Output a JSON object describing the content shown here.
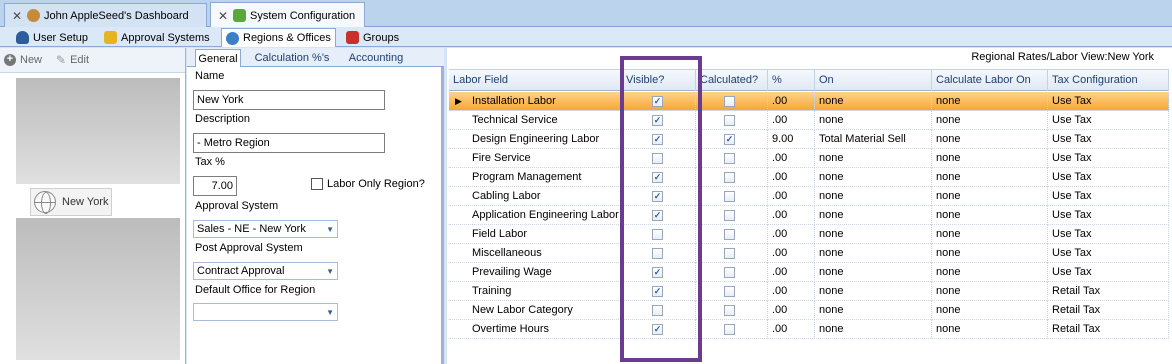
{
  "doc_tabs": [
    {
      "label": "John AppleSeed's Dashboard",
      "icon": "dashboard-icon"
    },
    {
      "label": "System Configuration",
      "icon": "puzzle-icon"
    }
  ],
  "module_tabs": [
    {
      "label": "User Setup",
      "icon": "user-icon"
    },
    {
      "label": "Approval Systems",
      "icon": "approval-icon"
    },
    {
      "label": "Regions & Offices",
      "icon": "globe-icon"
    },
    {
      "label": "Groups",
      "icon": "groups-icon"
    }
  ],
  "left_toolbar": {
    "new_label": "New",
    "edit_label": "Edit"
  },
  "region_list": {
    "selected": "New York"
  },
  "form_tabs": [
    "General",
    "Calculation %'s",
    "Accounting"
  ],
  "form": {
    "name_label": "Name",
    "name_value": "New York",
    "description_label": "Description",
    "description_value": "- Metro Region",
    "tax_label": "Tax %",
    "tax_value": "7.00",
    "labor_only_label": "Labor Only Region?",
    "approval_system_label": "Approval System",
    "approval_system_value": "Sales - NE - New York",
    "post_approval_label": "Post Approval System",
    "post_approval_value": "Contract Approval",
    "default_office_label": "Default Office for Region",
    "default_office_value": ""
  },
  "grid": {
    "title": "Regional Rates/Labor View:New York",
    "headers": [
      "Labor Field",
      "Visible?",
      "Calculated?",
      "%",
      "On",
      "Calculate Labor On",
      "Tax Configuration"
    ],
    "rows": [
      {
        "field": "Installation Labor",
        "visible": true,
        "calculated": false,
        "pct": ".00",
        "on": "none",
        "calc_on": "none",
        "tax": "Use Tax",
        "selected": true
      },
      {
        "field": "Technical Service",
        "visible": true,
        "calculated": false,
        "pct": ".00",
        "on": "none",
        "calc_on": "none",
        "tax": "Use Tax"
      },
      {
        "field": "Design Engineering Labor",
        "visible": true,
        "calculated": true,
        "pct": "9.00",
        "on": "Total Material Sell",
        "calc_on": "none",
        "tax": "Use Tax"
      },
      {
        "field": "Fire Service",
        "visible": false,
        "calculated": false,
        "pct": ".00",
        "on": "none",
        "calc_on": "none",
        "tax": "Use Tax"
      },
      {
        "field": "Program Management",
        "visible": true,
        "calculated": false,
        "pct": ".00",
        "on": "none",
        "calc_on": "none",
        "tax": "Use Tax"
      },
      {
        "field": "Cabling Labor",
        "visible": true,
        "calculated": false,
        "pct": ".00",
        "on": "none",
        "calc_on": "none",
        "tax": "Use Tax"
      },
      {
        "field": "Application Engineering Labor",
        "visible": true,
        "calculated": false,
        "pct": ".00",
        "on": "none",
        "calc_on": "none",
        "tax": "Use Tax"
      },
      {
        "field": "Field Labor",
        "visible": false,
        "calculated": false,
        "pct": ".00",
        "on": "none",
        "calc_on": "none",
        "tax": "Use Tax"
      },
      {
        "field": "Miscellaneous",
        "visible": false,
        "calculated": false,
        "pct": ".00",
        "on": "none",
        "calc_on": "none",
        "tax": "Use Tax"
      },
      {
        "field": "Prevailing Wage",
        "visible": true,
        "calculated": false,
        "pct": ".00",
        "on": "none",
        "calc_on": "none",
        "tax": "Use Tax"
      },
      {
        "field": "Training",
        "visible": true,
        "calculated": false,
        "pct": ".00",
        "on": "none",
        "calc_on": "none",
        "tax": "Retail Tax"
      },
      {
        "field": "New Labor Category",
        "visible": false,
        "calculated": false,
        "pct": ".00",
        "on": "none",
        "calc_on": "none",
        "tax": "Retail Tax"
      },
      {
        "field": "Overtime Hours",
        "visible": true,
        "calculated": false,
        "pct": ".00",
        "on": "none",
        "calc_on": "none",
        "tax": "Retail Tax"
      }
    ]
  },
  "colors": {
    "highlight": "#6a3b8f",
    "selected_row": "#f7a637",
    "accent": "#1e3f70"
  }
}
